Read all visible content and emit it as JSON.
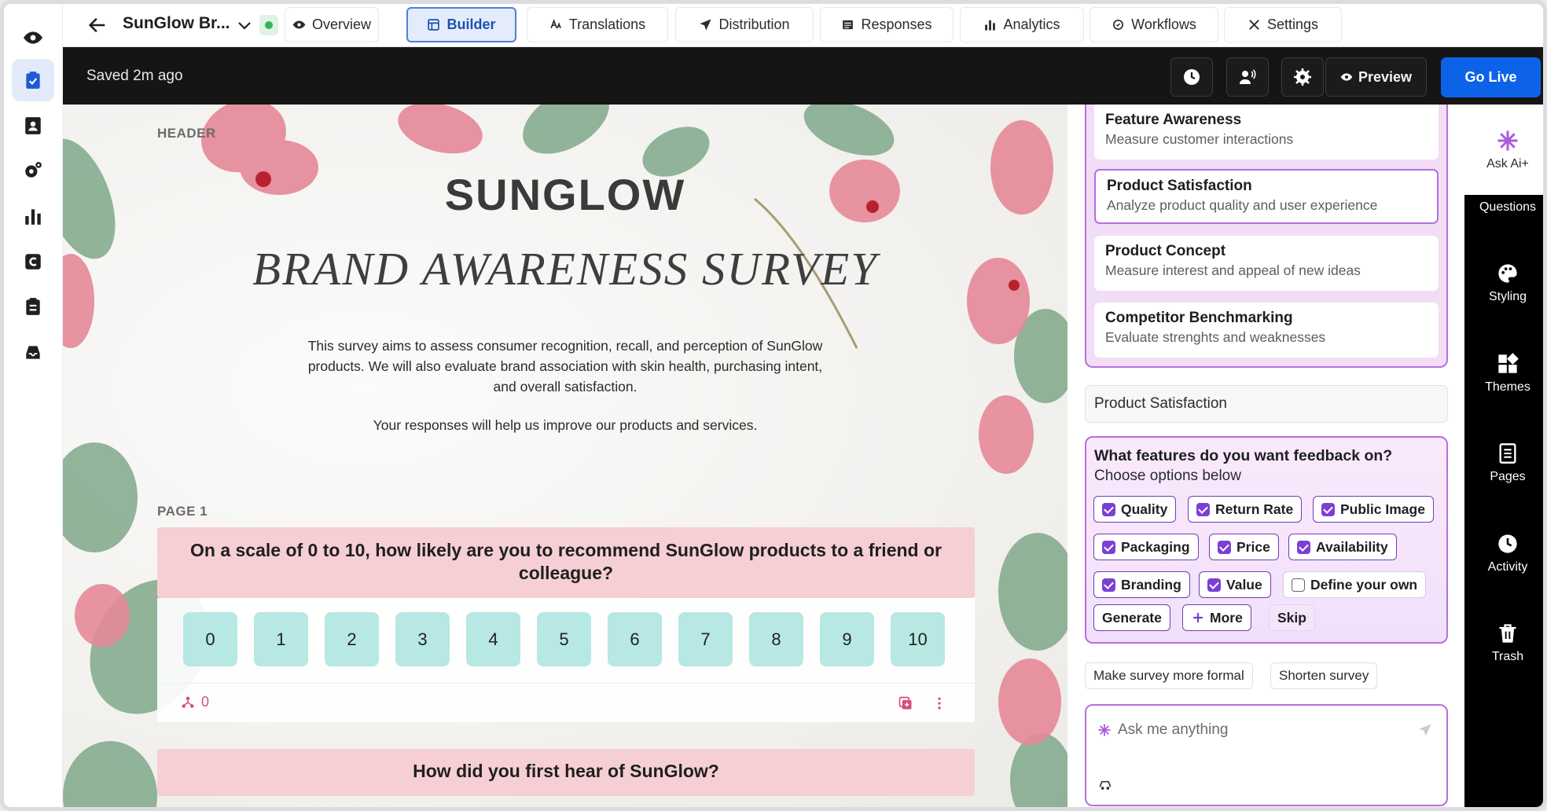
{
  "header": {
    "survey_name": "SunGlow Br...",
    "tabs": [
      {
        "label": "Overview",
        "icon": "eye-icon"
      },
      {
        "label": "Builder",
        "icon": "layout-icon"
      },
      {
        "label": "Translations",
        "icon": "translate-icon"
      },
      {
        "label": "Distribution",
        "icon": "send-icon"
      },
      {
        "label": "Responses",
        "icon": "responses-icon"
      },
      {
        "label": "Analytics",
        "icon": "bar-chart-icon"
      },
      {
        "label": "Workflows",
        "icon": "workflow-icon"
      },
      {
        "label": "Settings",
        "icon": "tools-icon"
      }
    ],
    "active_tab": "Builder"
  },
  "toolbar": {
    "saved_status": "Saved 2m ago",
    "preview_label": "Preview",
    "go_live_label": "Go Live"
  },
  "left_rail": [
    "eye-icon",
    "survey-icon",
    "contacts-icon",
    "gear-icon",
    "analytics-icon",
    "c-logo-icon",
    "clipboard-icon",
    "inbox-icon"
  ],
  "canvas": {
    "header_label": "HEADER",
    "brand": "SUNGLOW",
    "title": "BRAND AWARENESS SURVEY",
    "intro": "This survey aims to assess consumer recognition, recall, and perception of SunGlow products. We will also evaluate brand association with skin health, purchasing intent, and overall satisfaction.",
    "intro2": "Your responses will help us improve our products and services.",
    "page_label": "PAGE 1",
    "question1": "On a scale of 0 to 10, how likely are you to recommend SunGlow products to a friend or colleague?",
    "scale": [
      "0",
      "1",
      "2",
      "3",
      "4",
      "5",
      "6",
      "7",
      "8",
      "9",
      "10"
    ],
    "count": "0",
    "question2": "How did you first hear of SunGlow?"
  },
  "panel": {
    "templates": [
      {
        "title": "Feature Awareness",
        "subtitle": "Measure customer interactions"
      },
      {
        "title": "Product Satisfaction",
        "subtitle": "Analyze product quality and user experience"
      },
      {
        "title": "Product Concept",
        "subtitle": "Measure interest and appeal of new ideas"
      },
      {
        "title": "Competitor Benchmarking",
        "subtitle": "Evaluate strenghts and weaknesses"
      }
    ],
    "chosen": "Product Satisfaction",
    "ai_question": "What features do you want feedback on?",
    "ai_sub": "Choose options below",
    "options": [
      {
        "label": "Quality",
        "checked": true
      },
      {
        "label": "Return Rate",
        "checked": true
      },
      {
        "label": "Public Image",
        "checked": true
      },
      {
        "label": "Packaging",
        "checked": true
      },
      {
        "label": "Price",
        "checked": true
      },
      {
        "label": "Availability",
        "checked": true
      },
      {
        "label": "Branding",
        "checked": true
      },
      {
        "label": "Value",
        "checked": true
      },
      {
        "label": "Define your own",
        "checked": false
      }
    ],
    "generate_label": "Generate",
    "more_label": "More",
    "skip_label": "Skip",
    "suggestions": [
      "Make survey more formal",
      "Shorten survey"
    ],
    "ask_placeholder": "Ask me anything"
  },
  "right_rail": {
    "ask_ai_label": "Ask Ai+",
    "items": [
      {
        "label": "Questions",
        "icon": "questions-icon"
      },
      {
        "label": "Styling",
        "icon": "palette-icon"
      },
      {
        "label": "Themes",
        "icon": "themes-icon"
      },
      {
        "label": "Pages",
        "icon": "pages-icon"
      },
      {
        "label": "Activity",
        "icon": "clock-icon"
      },
      {
        "label": "Trash",
        "icon": "trash-icon"
      }
    ]
  },
  "colors": {
    "accent": "#0d63e8",
    "ai_purple": "#b76fdd",
    "question_pink": "#f6cfd4",
    "scale_teal": "#b7e8e3"
  }
}
